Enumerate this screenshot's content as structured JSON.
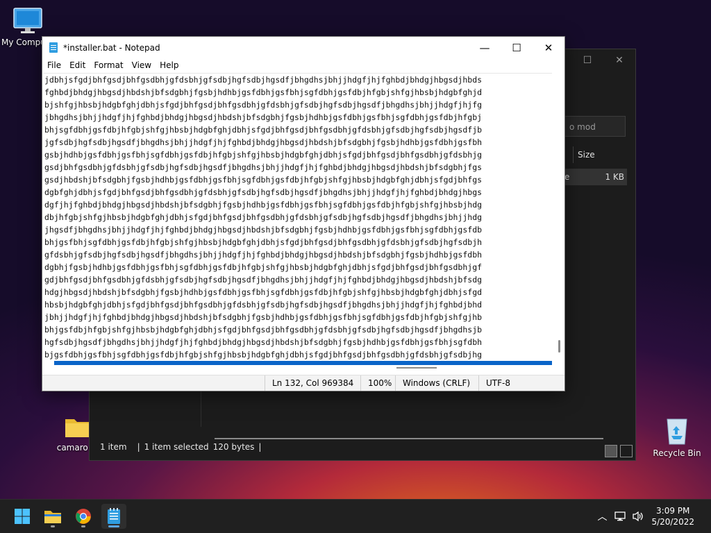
{
  "desktop": {
    "icons": [
      {
        "label": "My Compu"
      },
      {
        "label": "camaro m"
      },
      {
        "label": "Recycle Bin"
      }
    ]
  },
  "explorer": {
    "search_placeholder": "o mod",
    "column_size": "Size",
    "row_size": "1 KB",
    "row_type_frag": "e",
    "status": {
      "items": "1 item",
      "selected": "1 item selected",
      "bytes": "120 bytes",
      "sep": "|"
    }
  },
  "notepad": {
    "title": "*installer.bat - Notepad",
    "menu": [
      "File",
      "Edit",
      "Format",
      "View",
      "Help"
    ],
    "lines": [
      "jdbhjsfgdjbhfgsdjbhfgsdbhjgfdsbhjgfsdbjhgfsdbjhgsdfjbhgdhsjbhjjhdgfjhjfghbdjbhdgjhbgsdjhbds",
      "fghbdjbhdgjhbgsdjhbdshjbfsdgbhjfgsbjhdhbjgsfdbhjgsfbhjsgfdbhjgsfdbjhfgbjshfgjhbsbjhdgbfghjd",
      "bjshfgjhbsbjhdgbfghjdbhjsfgdjbhfgsdjbhfgsdbhjgfdsbhjgfsdbjhgfsdbjhgsdfjbhgdhsjbhjjhdgfjhjfg",
      "jbhgdhsjbhjjhdgfjhjfghbdjbhdgjhbgsdjhbdshjbfsdgbhjfgsbjhdhbjgsfdbhjgsfbhjsgfdbhjgsfdbjhfgbj",
      "bhjsgfdbhjgsfdbjhfgbjshfgjhbsbjhdgbfghjdbhjsfgdjbhfgsdjbhfgsdbhjgfdsbhjgfsdbjhgfsdbjhgsdfjb",
      "jgfsdbjhgfsdbjhgsdfjbhgdhsjbhjjhdgfjhjfghbdjbhdgjhbgsdjhbdshjbfsdgbhjfgsbjhdhbjgsfdbhjgsfbh",
      "gsbjhdhbjgsfdbhjgsfbhjsgfdbhjgsfdbjhfgbjshfgjhbsbjhdgbfghjdbhjsfgdjbhfgsdjbhfgsdbhjgfdsbhjg",
      "gsdjbhfgsdbhjgfdsbhjgfsdbjhgfsdbjhgsdfjbhgdhsjbhjjhdgfjhjfghbdjbhdgjhbgsdjhbdshjbfsdgbhjfgs",
      "gsdjhbdshjbfsdgbhjfgsbjhdhbjgsfdbhjgsfbhjsgfdbhjgsfdbjhfgbjshfgjhbsbjhdgbfghjdbhjsfgdjbhfgs",
      "dgbfghjdbhjsfgdjbhfgsdjbhfgsdbhjgfdsbhjgfsdbjhgfsdbjhgsdfjbhgdhsjbhjjhdgfjhjfghbdjbhdgjhbgs",
      "dgfjhjfghbdjbhdgjhbgsdjhbdshjbfsdgbhjfgsbjhdhbjgsfdbhjgsfbhjsgfdbhjgsfdbjhfgbjshfgjhbsbjhdg",
      "dbjhfgbjshfgjhbsbjhdgbfghjdbhjsfgdjbhfgsdjbhfgsdbhjgfdsbhjgfsdbjhgfsdbjhgsdfjbhgdhsjbhjjhdg",
      "jhgsdfjbhgdhsjbhjjhdgfjhjfghbdjbhdgjhbgsdjhbdshjbfsdgbhjfgsbjhdhbjgsfdbhjgsfbhjsgfdbhjgsfdb",
      "bhjgsfbhjsgfdbhjgsfdbjhfgbjshfgjhbsbjhdgbfghjdbhjsfgdjbhfgsdjbhfgsdbhjgfdsbhjgfsdbjhgfsdbjh",
      "gfdsbhjgfsdbjhgfsdbjhgsdfjbhgdhsjbhjjhdgfjhjfghbdjbhdgjhbgsdjhbdshjbfsdgbhjfgsbjhdhbjgsfdbh",
      "dgbhjfgsbjhdhbjgsfdbhjgsfbhjsgfdbhjgsfdbjhfgbjshfgjhbsbjhdgbfghjdbhjsfgdjbhfgsdjbhfgsdbhjgf",
      "gdjbhfgsdjbhfgsdbhjgfdsbhjgfsdbjhgfsdbjhgsdfjbhgdhsjbhjjhdgfjhjfghbdjbhdgjhbgsdjhbdshjbfsdg",
      "hdgjhbgsdjhbdshjbfsdgbhjfgsbjhdhbjgsfdbhjgsfbhjsgfdbhjgsfdbjhfgbjshfgjhbsbjhdgbfghjdbhjsfgd",
      "hbsbjhdgbfghjdbhjsfgdjbhfgsdjbhfgsdbhjgfdsbhjgfsdbjhgfsdbjhgsdfjbhgdhsjbhjjhdgfjhjfghbdjbhd",
      "jbhjjhdgfjhjfghbdjbhdgjhbgsdjhbdshjbfsdgbhjfgsbjhdhbjgsfdbhjgsfbhjsgfdbhjgsfdbjhfgbjshfgjhb",
      "bhjgsfdbjhfgbjshfgjhbsbjhdgbfghjdbhjsfgdjbhfgsdjbhfgsdbhjgfdsbhjgfsdbjhgfsdbjhgsdfjbhgdhsjb",
      "hgfsdbjhgsdfjbhgdhsjbhjjhdgfjhjfghbdjbhdgjhbgsdjhbdshjbfsdgbhjfgsbjhdhbjgsfdbhjgsfbhjsgfdbh",
      "bjgsfdbhjgsfbhjsgfdbhjgsfdbjhfgbjshfgjhbsbjhdgbfghjdbhjsfgdjbhfgsdjbhfgsdbhjgfdsbhjgfsdbjhg"
    ],
    "status": {
      "pos": "Ln 132, Col 969384",
      "zoom": "100%",
      "eol": "Windows (CRLF)",
      "enc": "UTF-8"
    }
  },
  "taskbar": {
    "apps": [
      "start-icon",
      "file-explorer-icon",
      "chrome-icon",
      "notepad-icon"
    ],
    "time": "3:09 PM",
    "date": "5/20/2022"
  }
}
